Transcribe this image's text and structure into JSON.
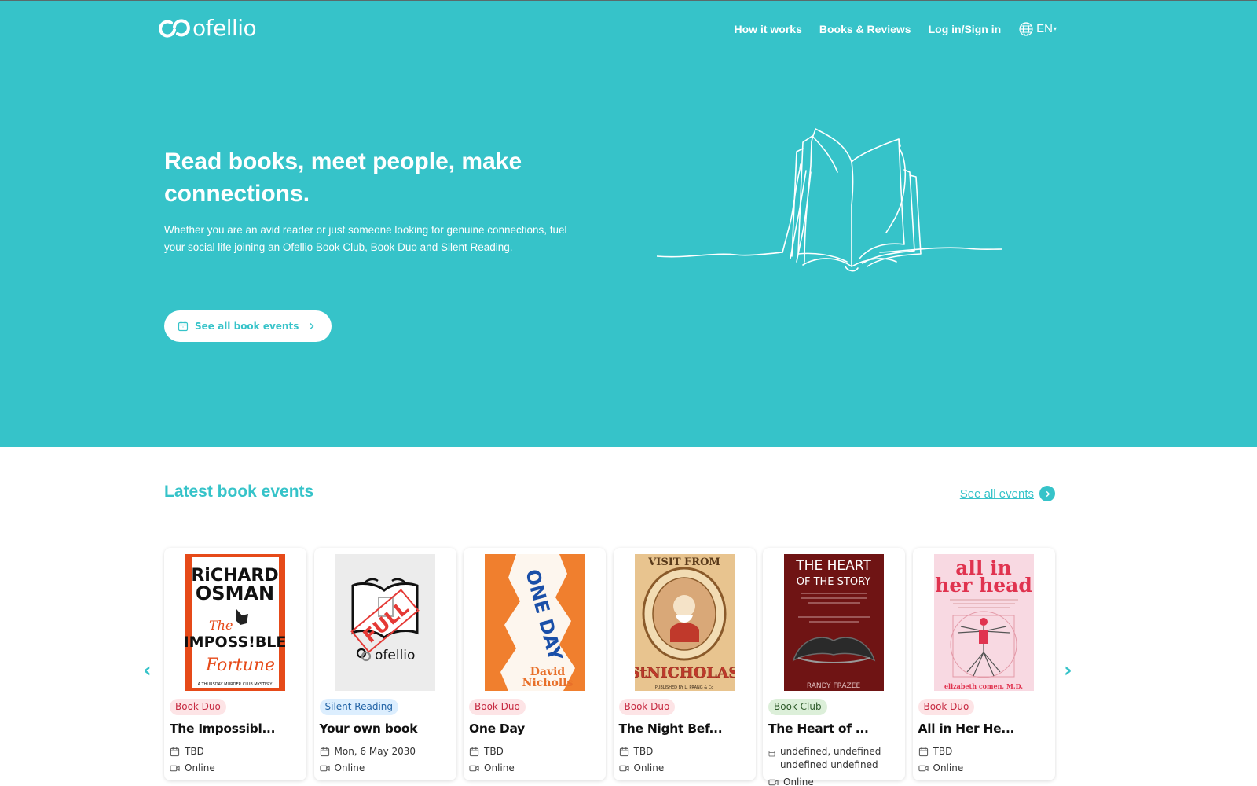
{
  "brand": {
    "name": "ofellio",
    "color": "#36c3c9"
  },
  "nav": {
    "links": [
      {
        "label": "How it works"
      },
      {
        "label": "Books & Reviews"
      },
      {
        "label": "Log in/Sign in"
      }
    ],
    "language": "EN"
  },
  "hero": {
    "title": "Read books, meet people, make connections.",
    "subtitle": "Whether you are an avid reader or just someone looking for genuine connections, fuel your social life joining an Ofellio Book Club, Book Duo and Silent Reading.",
    "cta": "See all book events"
  },
  "events": {
    "title": "Latest book events",
    "see_all": "See all events",
    "cards": [
      {
        "type": "Book Duo",
        "type_color": "duo",
        "title": "The Impossibl...",
        "date": "TBD",
        "location": "Online",
        "cover": {
          "lines": [
            "RiCHARD",
            "OSMAN",
            "The",
            "IMPOSS!BLE",
            "Fortune",
            "A THURSDAY MURDER CLUB MYSTERY"
          ],
          "bg": "#ffffff",
          "accent": "#e64a19"
        }
      },
      {
        "type": "Silent Reading",
        "type_color": "silent",
        "title": "Your own book",
        "date": "Mon, 6 May 2030",
        "location": "Online",
        "cover": {
          "lines": [
            "FULL",
            "ofellio"
          ],
          "bg": "#ececec",
          "accent": "#e53935"
        }
      },
      {
        "type": "Book Duo",
        "type_color": "duo",
        "title": "One Day",
        "date": "TBD",
        "location": "Online",
        "cover": {
          "lines": [
            "ONE DAY",
            "David",
            "Nicholls"
          ],
          "bg": "#f07f2e",
          "accent": "#1a4fa8"
        }
      },
      {
        "type": "Book Duo",
        "type_color": "duo",
        "title": "The Night Bef...",
        "date": "TBD",
        "location": "Online",
        "cover": {
          "lines": [
            "VISIT FROM",
            "St NICHOLAS",
            "PUBLISHED BY L. PRANG & Co"
          ],
          "bg": "#e8c48f",
          "accent": "#c0392b"
        }
      },
      {
        "type": "Book Club",
        "type_color": "club",
        "title": "The Heart of ...",
        "date": "undefined, undefined undefined undefined",
        "location": "Online",
        "cover": {
          "lines": [
            "THE HEART",
            "OF THE STORY",
            "RANDY FRAZEE"
          ],
          "bg": "#6f1414",
          "accent": "#ffffff"
        }
      },
      {
        "type": "Book Duo",
        "type_color": "duo",
        "title": "All in Her He...",
        "date": "TBD",
        "location": "Online",
        "cover": {
          "lines": [
            "all in",
            "her head",
            "elizabeth comen, M.D."
          ],
          "bg": "#f8d9e2",
          "accent": "#e0334f"
        }
      }
    ]
  }
}
